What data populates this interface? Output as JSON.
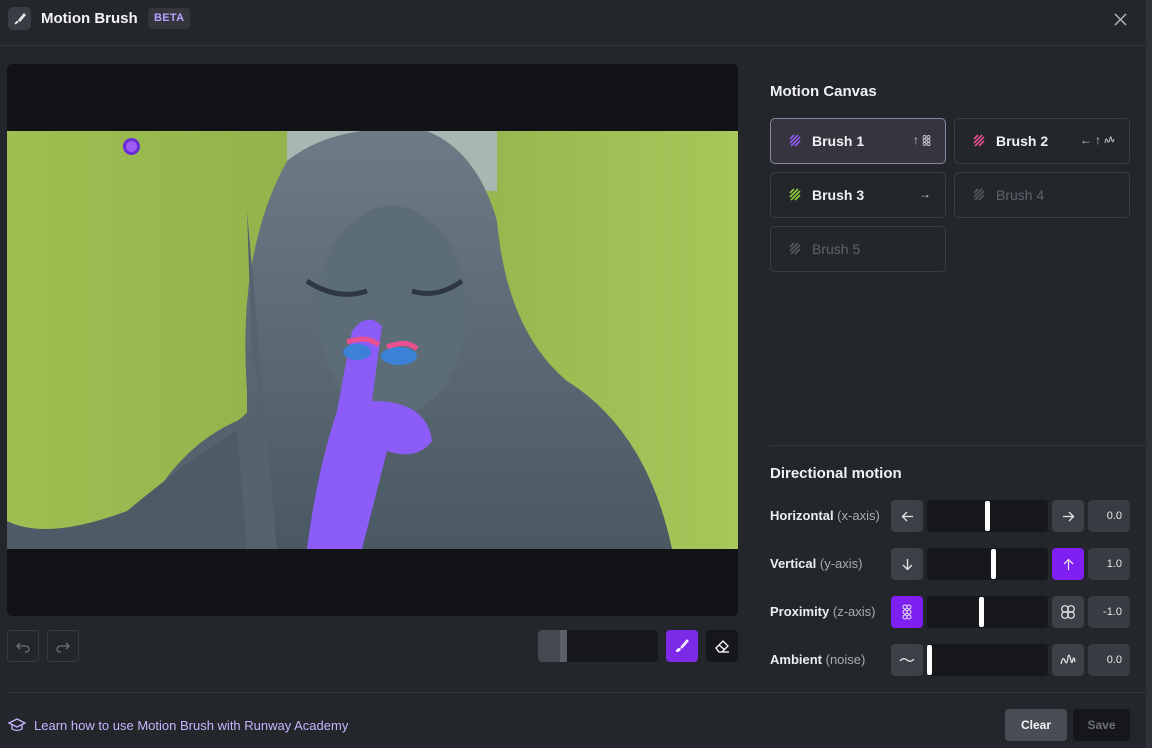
{
  "header": {
    "title": "Motion Brush",
    "badge": "BETA",
    "icons": {
      "app": "brush-icon",
      "close": "close-icon"
    }
  },
  "canvas": {
    "toolbar": {
      "undo_icon": "undo-icon",
      "redo_icon": "redo-icon",
      "brush_size_fraction": 0.24,
      "brush_icon": "paint-brush-icon",
      "eraser_icon": "eraser-icon"
    }
  },
  "motion_canvas": {
    "title": "Motion Canvas",
    "brushes": [
      {
        "label": "Brush 1",
        "color": "#8b5cf6",
        "dirs": [
          "↑",
          "proximity"
        ],
        "active": true,
        "enabled": true
      },
      {
        "label": "Brush 2",
        "color": "#e8508f",
        "dirs": [
          "←",
          "↑",
          "ambient"
        ],
        "active": false,
        "enabled": true
      },
      {
        "label": "Brush 3",
        "color": "#8fcf3a",
        "dirs": [
          "→"
        ],
        "active": false,
        "enabled": true
      },
      {
        "label": "Brush 4",
        "color": "#55585f",
        "dirs": [],
        "active": false,
        "enabled": false
      },
      {
        "label": "Brush 5",
        "color": "#55585f",
        "dirs": [],
        "active": false,
        "enabled": false
      }
    ]
  },
  "directional_motion": {
    "title": "Directional motion",
    "rows": [
      {
        "label": "Horizontal",
        "sub": "(x-axis)",
        "value": "0.0",
        "level": 0.5,
        "left_icon": "arrow-left-icon",
        "right_icon": "arrow-right-icon",
        "active": "none"
      },
      {
        "label": "Vertical",
        "sub": "(y-axis)",
        "value": "1.0",
        "level": 0.55,
        "left_icon": "arrow-down-icon",
        "right_icon": "arrow-up-icon",
        "active": "right"
      },
      {
        "label": "Proximity",
        "sub": "(z-axis)",
        "value": "-1.0",
        "level": 0.45,
        "left_icon": "dots-cluster-icon",
        "right_icon": "circles-icon",
        "active": "left"
      },
      {
        "label": "Ambient",
        "sub": "(noise)",
        "value": "0.0",
        "level": 0.0,
        "left_icon": "wave-icon",
        "right_icon": "noise-wave-icon",
        "active": "none"
      }
    ]
  },
  "footer": {
    "academy_link": "Learn how to use Motion Brush with Runway Academy",
    "academy_icon": "graduation-cap-icon",
    "clear_label": "Clear",
    "save_label": "Save"
  },
  "colors": {
    "accent": "#7d1ff0",
    "mask_purple": "#8b5cf6",
    "mask_pink": "#e8508f",
    "mask_blue": "#3b82d6",
    "mask_green": "#a7cf3e"
  }
}
